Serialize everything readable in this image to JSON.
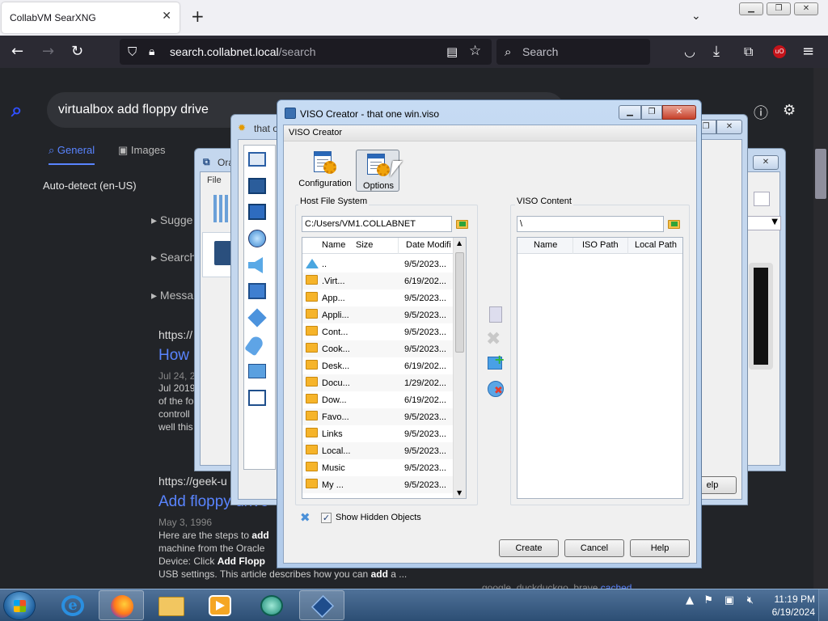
{
  "browser": {
    "tab_title": "CollabVM SearXNG",
    "url_host": "search.collabnet.local",
    "url_path": "/search",
    "search_placeholder": "Search"
  },
  "searx": {
    "query": "virtualbox add floppy drive",
    "categories": [
      "General",
      "Images"
    ],
    "language": "Auto-detect (en-US)",
    "side_items": [
      "Sugge",
      "Search",
      "Messa"
    ],
    "results": [
      {
        "url": "https://",
        "title": "How",
        "date": "Jul 24, 2",
        "body": [
          "Jul 2019",
          "of the fo",
          "controll",
          "well this"
        ]
      },
      {
        "url": "https://geek-u",
        "title": "Add floppy drive",
        "date": "May 3, 1996",
        "body_parts": [
          "Here are the steps to ",
          "add",
          " machine from the Oracle ",
          "Device: Click ",
          "Add Flopp",
          " USB settings. This article describes how you can ",
          "add",
          " a ..."
        ]
      }
    ],
    "engines": "google, duckduckgo, brave",
    "cached": "cached"
  },
  "bg_windows": {
    "vbox_title": "Ora",
    "vbox_menu": "File",
    "settings_title": "that o",
    "help_btn": "elp"
  },
  "viso": {
    "title": "VISO Creator - that one win.viso",
    "menu": "VISO Creator",
    "tools": [
      {
        "label": "Configuration",
        "icon": "configuration-icon"
      },
      {
        "label": "Options",
        "icon": "options-icon"
      }
    ],
    "host_group": "Host File System",
    "host_path": "C:/Users/VM1.COLLABNET",
    "host_columns": [
      "Name",
      "Size",
      "Date Modifi"
    ],
    "host_rows": [
      {
        "name": "..",
        "date": "9/5/2023...",
        "up": true
      },
      {
        "name": ".Virt...",
        "date": "6/19/202..."
      },
      {
        "name": "App...",
        "date": "9/5/2023..."
      },
      {
        "name": "Appli...",
        "date": "9/5/2023..."
      },
      {
        "name": "Cont...",
        "date": "9/5/2023..."
      },
      {
        "name": "Cook...",
        "date": "9/5/2023..."
      },
      {
        "name": "Desk...",
        "date": "6/19/202..."
      },
      {
        "name": "Docu...",
        "date": "1/29/202..."
      },
      {
        "name": "Dow...",
        "date": "6/19/202..."
      },
      {
        "name": "Favo...",
        "date": "9/5/2023..."
      },
      {
        "name": "Links",
        "date": "9/5/2023..."
      },
      {
        "name": "Local...",
        "date": "9/5/2023..."
      },
      {
        "name": "Music",
        "date": "9/5/2023..."
      },
      {
        "name": "My ...",
        "date": "9/5/2023..."
      }
    ],
    "viso_group": "VISO Content",
    "viso_path": "\\",
    "viso_columns": [
      "Name",
      "ISO Path",
      "Local Path"
    ],
    "show_hidden_label": "Show Hidden Objects",
    "show_hidden_checked": "✓",
    "buttons": {
      "create": "Create",
      "cancel": "Cancel",
      "help": "Help"
    }
  },
  "taskbar": {
    "time": "11:19 PM",
    "date": "6/19/2024"
  }
}
